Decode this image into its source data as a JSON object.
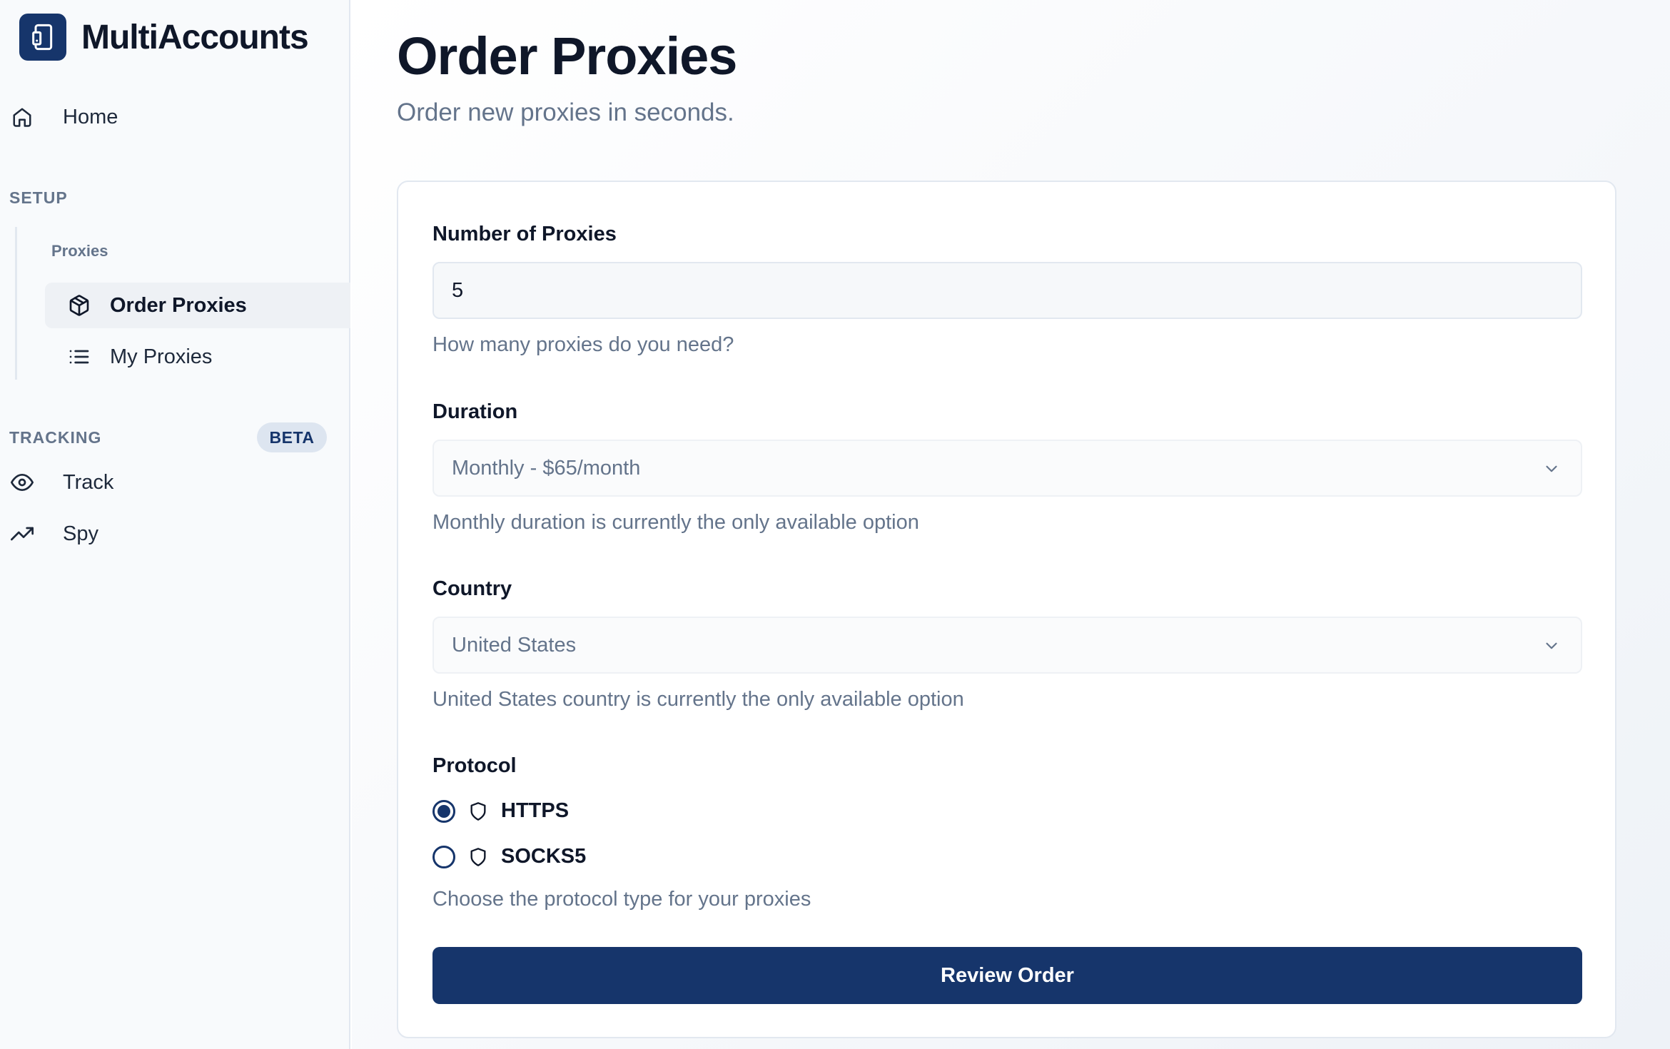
{
  "brand": {
    "name": "MultiAccounts",
    "icon": "device-icon"
  },
  "sidebar": {
    "home": {
      "label": "Home",
      "icon": "home-icon"
    },
    "setup": {
      "title": "SETUP",
      "group_label": "Proxies",
      "items": [
        {
          "label": "Order Proxies",
          "icon": "package-icon",
          "active": true
        },
        {
          "label": "My Proxies",
          "icon": "list-icon",
          "active": false
        }
      ]
    },
    "tracking": {
      "title": "TRACKING",
      "badge": "BETA",
      "items": [
        {
          "label": "Track",
          "icon": "eye-icon"
        },
        {
          "label": "Spy",
          "icon": "trending-up-icon"
        }
      ]
    }
  },
  "page": {
    "title": "Order Proxies",
    "subtitle": "Order new proxies in seconds."
  },
  "form": {
    "quantity": {
      "label": "Number of Proxies",
      "value": "5",
      "hint": "How many proxies do you need?"
    },
    "duration": {
      "label": "Duration",
      "value": "Monthly - $65/month",
      "hint": "Monthly duration is currently the only available option"
    },
    "country": {
      "label": "Country",
      "value": "United States",
      "hint": "United States country is currently the only available option"
    },
    "protocol": {
      "label": "Protocol",
      "options": [
        {
          "label": "HTTPS",
          "selected": true,
          "icon": "shield-icon"
        },
        {
          "label": "SOCKS5",
          "selected": false,
          "icon": "shield-icon"
        }
      ],
      "hint": "Choose the protocol type for your proxies"
    },
    "submit_label": "Review Order"
  },
  "colors": {
    "primary": "#16356b",
    "muted_text": "#64748b",
    "border": "#e2e8f0",
    "sidebar_bg": "#f8fafc",
    "active_item_bg": "#eef1f5",
    "badge_bg": "#dde5f0"
  }
}
